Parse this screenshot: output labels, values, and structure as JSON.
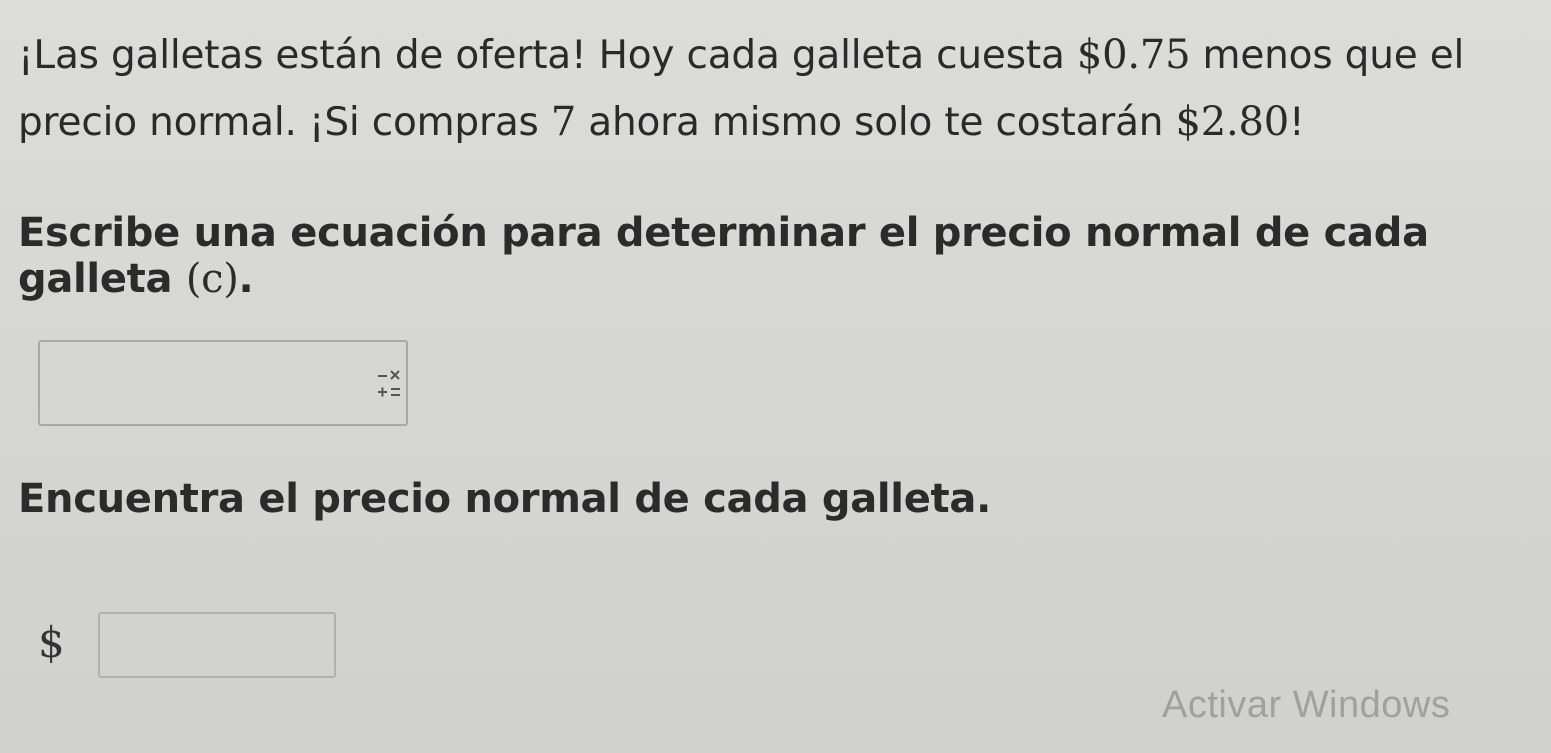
{
  "problem": {
    "line1_part1": "¡Las galletas están de oferta! Hoy cada galleta cuesta ",
    "line1_price": "$0.75",
    "line1_part2": " menos que el",
    "line2_part1": "precio normal. ¡Si compras ",
    "line2_qty": "7",
    "line2_part2": " ahora mismo solo te costarán ",
    "line2_total": "$2.80",
    "line2_end": "!"
  },
  "question1": {
    "text": "Escribe una ecuación para determinar el precio normal de cada galleta ",
    "variable": "(c)",
    "end": "."
  },
  "equation_input": {
    "value": "",
    "keypad_icon": "math-keypad-icon"
  },
  "question2": {
    "text": "Encuentra el precio normal de cada galleta."
  },
  "answer": {
    "currency": "$",
    "value": ""
  },
  "watermark": {
    "text": "Activar Windows"
  }
}
